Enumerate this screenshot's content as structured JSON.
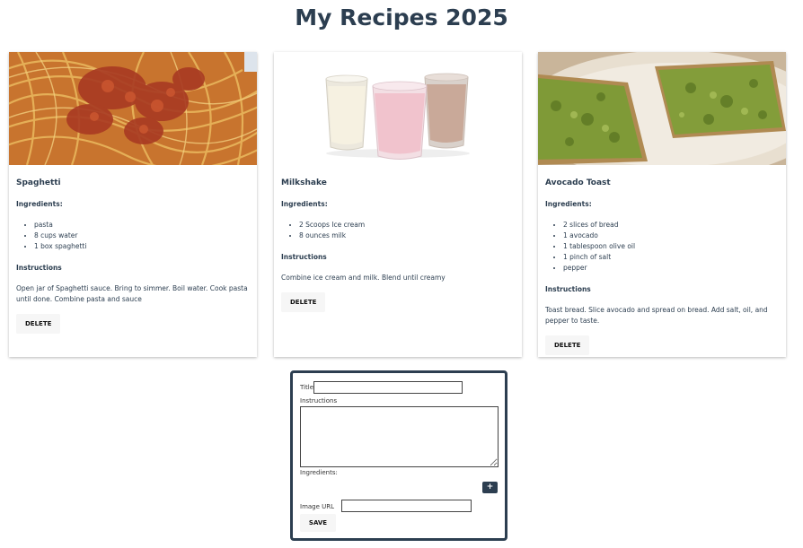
{
  "page": {
    "title": "My Recipes 2025"
  },
  "recipes": [
    {
      "title": "Spaghetti",
      "image_icon": "spaghetti-image",
      "ingredients_label": "Ingredients:",
      "ingredients": [
        "pasta",
        "8 cups water",
        "1 box spaghetti"
      ],
      "instructions_label": "Instructions",
      "instructions": "Open jar of Spaghetti sauce. Bring to simmer. Boil water. Cook pasta until done. Combine pasta and sauce",
      "delete_label": "DELETE"
    },
    {
      "title": "Milkshake",
      "image_icon": "milkshake-image",
      "ingredients_label": "Ingredients:",
      "ingredients": [
        "2 Scoops Ice cream",
        "8 ounces milk"
      ],
      "instructions_label": "Instructions",
      "instructions": "Combine ice cream and milk. Blend until creamy",
      "delete_label": "DELETE"
    },
    {
      "title": "Avocado Toast",
      "image_icon": "avocado-toast-image",
      "ingredients_label": "Ingredients:",
      "ingredients": [
        "2 slices of bread",
        "1 avocado",
        "1 tablespoon olive oil",
        "1 pinch of salt",
        "pepper"
      ],
      "instructions_label": "Instructions",
      "instructions": "Toast bread. Slice avocado and spread on bread. Add salt, oil, and pepper to taste.",
      "delete_label": "DELETE"
    }
  ],
  "form": {
    "title_label": "Title",
    "title_value": "",
    "instructions_label": "Instructions",
    "instructions_value": "",
    "ingredients_label": "Ingredients:",
    "add_ingredient_label": "+",
    "image_url_label": "Image URL",
    "image_url_value": "",
    "save_label": "SAVE"
  },
  "colors": {
    "primary": "#2c3e50",
    "button_bg": "#f6f6f6"
  }
}
